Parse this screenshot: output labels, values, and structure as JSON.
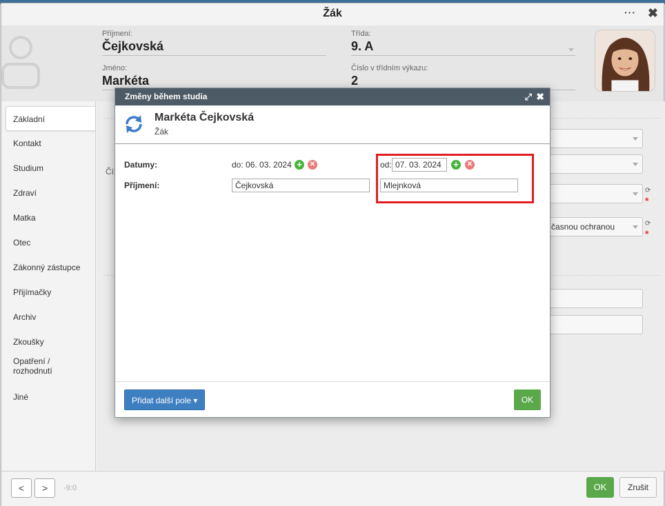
{
  "window": {
    "title": "Žák",
    "more_label": "···"
  },
  "student_header": {
    "surname_label": "Příjmení:",
    "surname_value": "Čejkovská",
    "firstname_label": "Jméno:",
    "firstname_value": "Markéta",
    "class_label": "Třída:",
    "class_value": "9. A",
    "class_number_label": "Číslo v třídním výkazu:",
    "class_number_value": "2"
  },
  "sidebar": {
    "items": [
      {
        "label": "Základní",
        "active": true
      },
      {
        "label": "Kontakt"
      },
      {
        "label": "Studium"
      },
      {
        "label": "Zdraví"
      },
      {
        "label": "Matka"
      },
      {
        "label": "Otec"
      },
      {
        "label": "Zákonný zástupce"
      },
      {
        "label": "Přijímačky"
      },
      {
        "label": "Archiv"
      },
      {
        "label": "Zkoušky"
      },
      {
        "label": "Opatření / rozhodnutí"
      },
      {
        "label": "Jiné"
      }
    ]
  },
  "background_content": {
    "partial_label_1": "Čís",
    "partial_value": "časnou ochranou"
  },
  "footer": {
    "prev_label": "<",
    "next_label": ">",
    "counter": "-9:0",
    "ok_label": "OK",
    "cancel_label": "Zrušit"
  },
  "modal": {
    "title": "Změny během studia",
    "person_name": "Markéta Čejkovská",
    "person_role": "Žák",
    "dates_label": "Datumy:",
    "date_to_text": "do: 06. 03. 2024",
    "date_from_prefix": "od:",
    "date_from_value": "07. 03. 2024",
    "surname_label": "Příjmení:",
    "surname_old": "Čejkovská",
    "surname_new": "Mlejnková",
    "add_field_label": "Přidat další pole ▾",
    "ok_label": "OK"
  },
  "colors": {
    "accent_blue": "#3e7fc1",
    "ok_green": "#5ba84b",
    "highlight_red": "#e11d22",
    "modal_bar": "#4d5b66"
  }
}
